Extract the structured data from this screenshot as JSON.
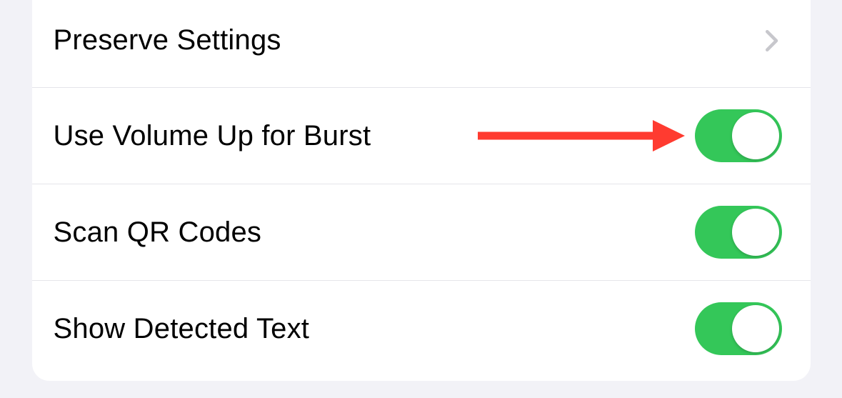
{
  "settings": {
    "items": [
      {
        "label": "Preserve Settings",
        "type": "navigation"
      },
      {
        "label": "Use Volume Up for Burst",
        "type": "toggle",
        "value": true,
        "highlighted": true
      },
      {
        "label": "Scan QR Codes",
        "type": "toggle",
        "value": true
      },
      {
        "label": "Show Detected Text",
        "type": "toggle",
        "value": true
      }
    ]
  },
  "colors": {
    "toggle_on": "#34c759",
    "arrow": "#ff3b30",
    "chevron": "#c7c7cc"
  }
}
